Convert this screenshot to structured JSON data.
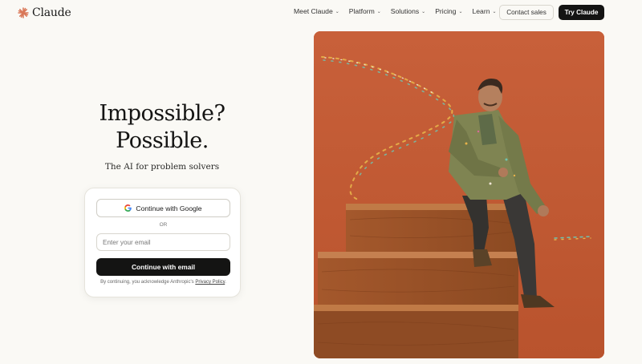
{
  "brand": {
    "name": "Claude",
    "accent": "#d97757"
  },
  "nav": {
    "items": [
      {
        "label": "Meet Claude",
        "icon": "chevron-down-icon"
      },
      {
        "label": "Platform",
        "icon": "chevron-down-icon"
      },
      {
        "label": "Solutions",
        "icon": "chevron-down-icon"
      },
      {
        "label": "Pricing",
        "icon": "chevron-down-icon"
      },
      {
        "label": "Learn",
        "icon": "chevron-down-icon"
      }
    ],
    "contact_label": "Contact sales",
    "try_label": "Try Claude"
  },
  "hero": {
    "headline_line1": "Impossible?",
    "headline_line2": "Possible.",
    "tagline": "The AI for problem solvers"
  },
  "signup": {
    "google_label": "Continue with Google",
    "or_label": "OR",
    "email_placeholder": "Enter your email",
    "email_value": "",
    "email_button_label": "Continue with email",
    "consent_text": "By continuing, you acknowledge Anthropic's",
    "privacy_link": "Privacy Policy",
    "consent_end": "."
  },
  "colors": {
    "background": "#faf9f5",
    "dark_button": "#141413",
    "hero_orange": "#c45a33"
  }
}
